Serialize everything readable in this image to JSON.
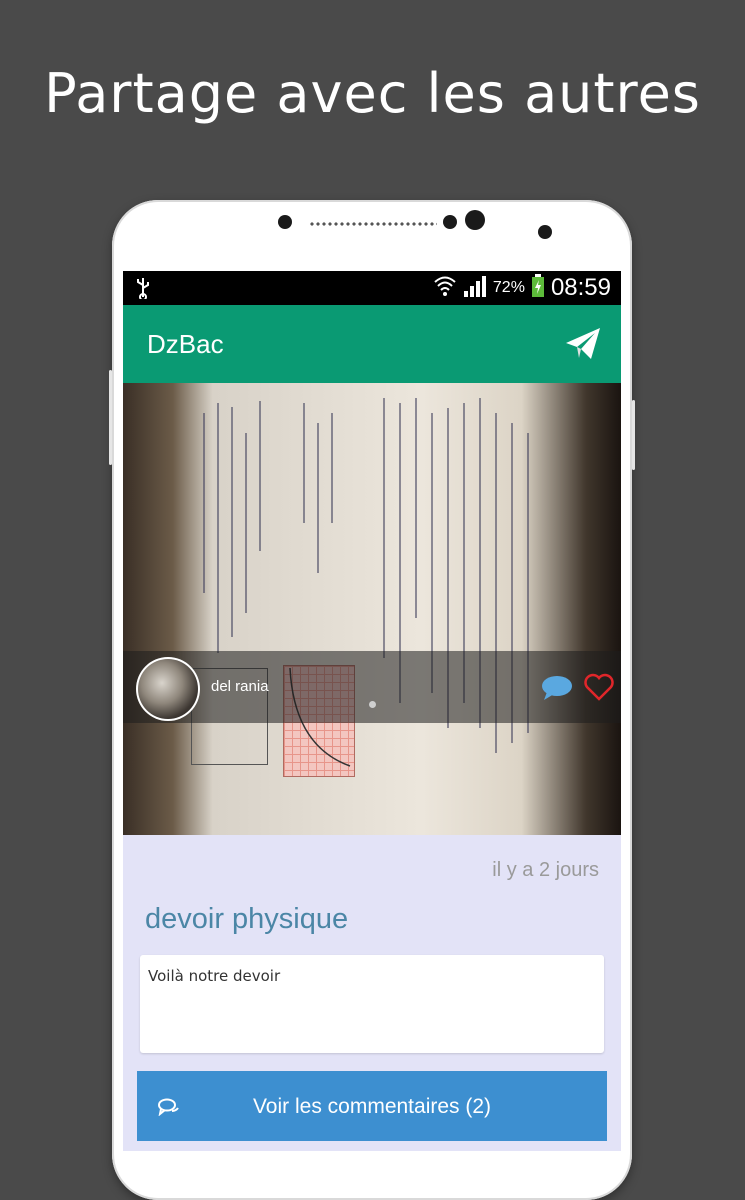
{
  "headline": "Partage avec les autres",
  "status_bar": {
    "battery": "72%",
    "time": "08:59"
  },
  "app_bar": {
    "title": "DzBac"
  },
  "post": {
    "author": "del rania",
    "date": "il y a 2 jours",
    "title": "devoir physique",
    "description": "Voilà notre devoir",
    "comments_button": "Voir les commentaires (2)"
  },
  "colors": {
    "app_bar": "#0a9a73",
    "button": "#3d8fd0",
    "heart": "#e0262a",
    "comment_bubble": "#5aa8e0",
    "title_text": "#4b86a6"
  }
}
